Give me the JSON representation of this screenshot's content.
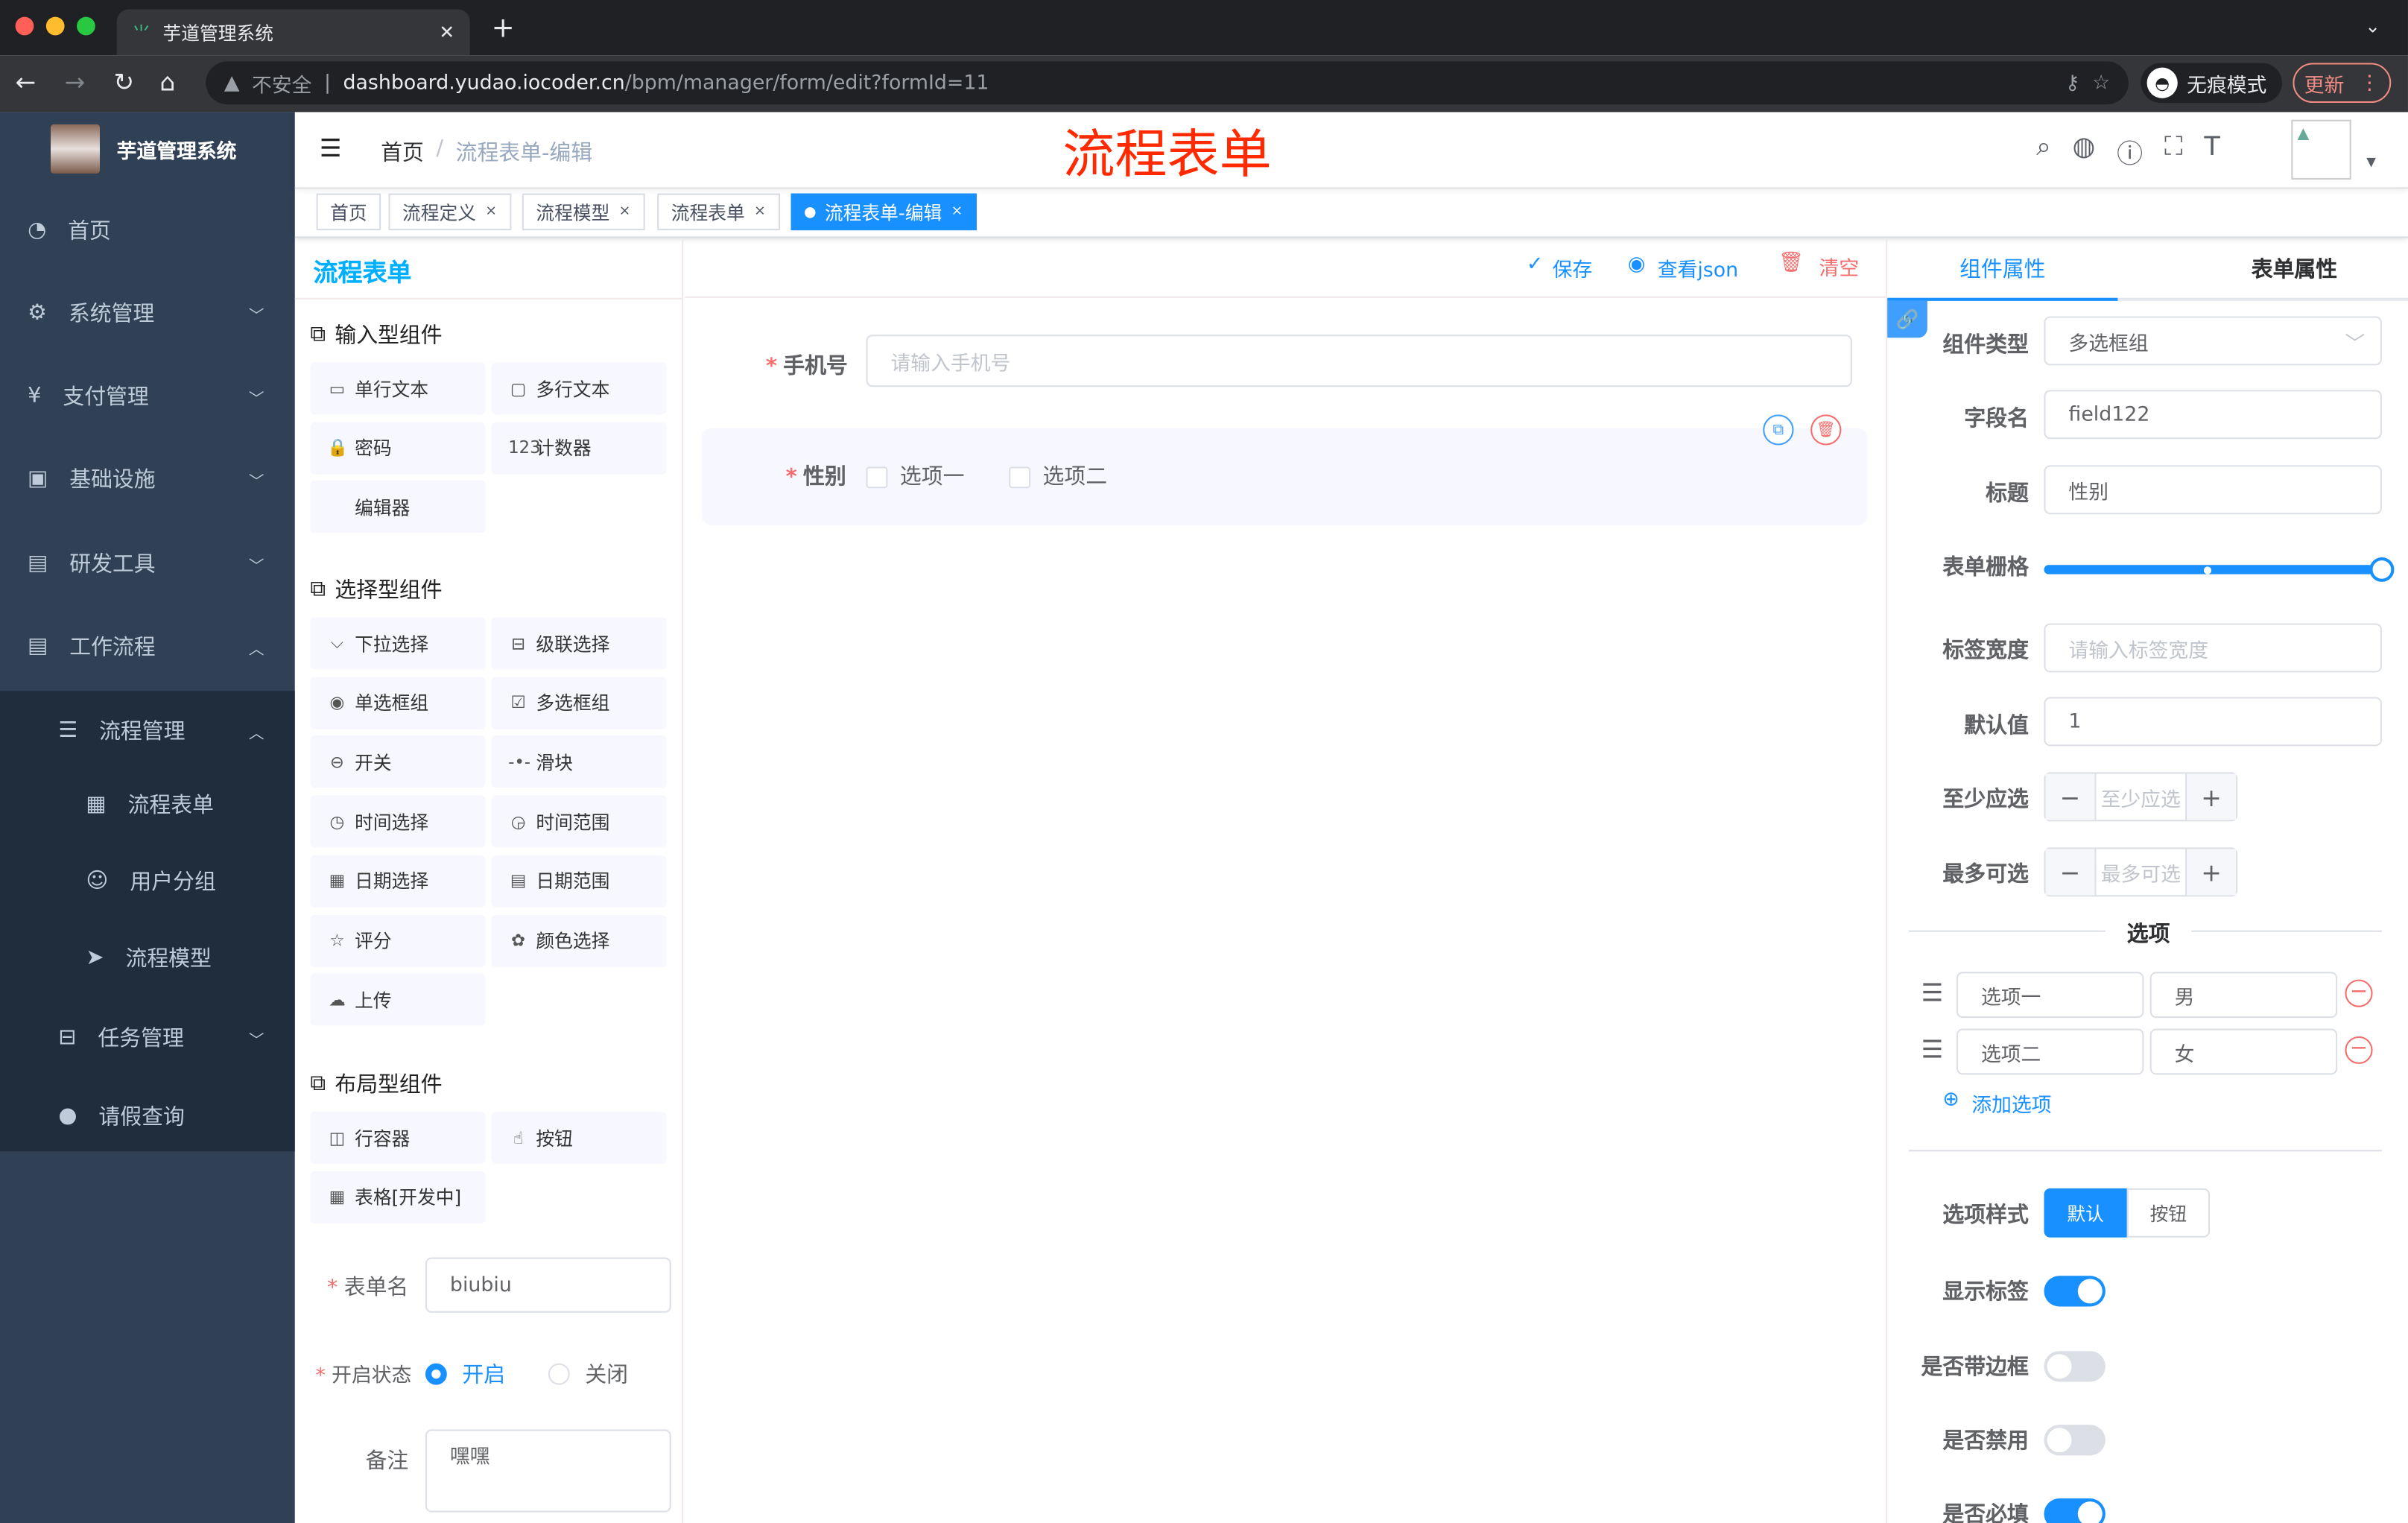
{
  "browser": {
    "tab_title": "芋道管理系统",
    "insecure": "不安全",
    "url_host": "dashboard.yudao.iocoder.cn",
    "url_path": "/bpm/manager/form/edit?formId=11",
    "incognito": "无痕模式",
    "update": "更新"
  },
  "sidebar": {
    "logo_title": "芋道管理系统",
    "items": [
      {
        "label": "首页",
        "icon": "dashboard-icon"
      },
      {
        "label": "系统管理",
        "icon": "gear-icon"
      },
      {
        "label": "支付管理",
        "icon": "yen-icon"
      },
      {
        "label": "基础设施",
        "icon": "monitor-icon"
      },
      {
        "label": "研发工具",
        "icon": "toolbox-icon"
      },
      {
        "label": "工作流程",
        "icon": "toolbox-icon"
      },
      {
        "label": "流程管理",
        "icon": "list-tree-icon"
      },
      {
        "label": "流程表单",
        "icon": "form-icon"
      },
      {
        "label": "用户分组",
        "icon": "people-icon"
      },
      {
        "label": "流程模型",
        "icon": "send-icon"
      },
      {
        "label": "任务管理",
        "icon": "tree-icon"
      },
      {
        "label": "请假查询",
        "icon": "user-icon"
      }
    ]
  },
  "navbar": {
    "breadcrumb": [
      "首页",
      "流程表单-编辑"
    ],
    "overlay_title": "流程表单"
  },
  "tags": [
    {
      "label": "首页"
    },
    {
      "label": "流程定义"
    },
    {
      "label": "流程模型"
    },
    {
      "label": "流程表单"
    },
    {
      "label": "流程表单-编辑",
      "active": true
    }
  ],
  "left": {
    "title": "流程表单",
    "categories": [
      {
        "title": "输入型组件",
        "items": [
          {
            "label": "单行文本",
            "icon": "input-icon"
          },
          {
            "label": "多行文本",
            "icon": "textarea-icon"
          },
          {
            "label": "密码",
            "icon": "lock-icon"
          },
          {
            "label": "计数器",
            "icon": "number-icon"
          },
          {
            "label": "编辑器",
            "icon": ""
          }
        ]
      },
      {
        "title": "选择型组件",
        "items": [
          {
            "label": "下拉选择",
            "icon": "select-icon"
          },
          {
            "label": "级联选择",
            "icon": "cascader-icon"
          },
          {
            "label": "单选框组",
            "icon": "radio-icon"
          },
          {
            "label": "多选框组",
            "icon": "checkbox-icon"
          },
          {
            "label": "开关",
            "icon": "switch-icon"
          },
          {
            "label": "滑块",
            "icon": "slider-icon"
          },
          {
            "label": "时间选择",
            "icon": "time-icon"
          },
          {
            "label": "时间范围",
            "icon": "time-range-icon"
          },
          {
            "label": "日期选择",
            "icon": "date-icon"
          },
          {
            "label": "日期范围",
            "icon": "date-range-icon"
          },
          {
            "label": "评分",
            "icon": "star-icon"
          },
          {
            "label": "颜色选择",
            "icon": "color-icon"
          },
          {
            "label": "上传",
            "icon": "upload-icon"
          }
        ]
      },
      {
        "title": "布局型组件",
        "items": [
          {
            "label": "行容器",
            "icon": "row-icon"
          },
          {
            "label": "按钮",
            "icon": "button-icon"
          },
          {
            "label": "表格[开发中]",
            "icon": "table-icon"
          }
        ]
      }
    ],
    "form_name_label": "表单名",
    "form_name": "biubiu",
    "status_label": "开启状态",
    "status_on": "开启",
    "status_off": "关闭",
    "remark_label": "备注",
    "remark": "嘿嘿"
  },
  "toolbar": {
    "save": "保存",
    "json": "查看json",
    "clear": "清空"
  },
  "canvas": {
    "phone_label": "手机号",
    "phone_placeholder": "请输入手机号",
    "gender_label": "性别",
    "options": [
      "选项一",
      "选项二"
    ]
  },
  "right": {
    "tabs": [
      "组件属性",
      "表单属性"
    ],
    "component_type_label": "组件类型",
    "component_type": "多选框组",
    "field_label": "字段名",
    "field": "field122",
    "title_label": "标题",
    "title": "性别",
    "grid_label": "表单栅格",
    "grid_value": 24,
    "grid_max": 24,
    "label_width_label": "标签宽度",
    "label_width_placeholder": "请输入标签宽度",
    "default_label": "默认值",
    "default": "1",
    "min_label": "至少应选",
    "min_placeholder": "至少应选",
    "max_label": "最多可选",
    "max_placeholder": "最多可选",
    "options_divider": "选项",
    "options": [
      {
        "label": "选项一",
        "value": "男"
      },
      {
        "label": "选项二",
        "value": "女"
      }
    ],
    "add_option": "添加选项",
    "style_label": "选项样式",
    "style_options": [
      "默认",
      "按钮"
    ],
    "show_label": "显示标签",
    "show_label_on": true,
    "border_label": "是否带边框",
    "border_on": false,
    "disabled_label": "是否禁用",
    "disabled_on": false,
    "required_label": "是否必填",
    "required_on": true
  },
  "colors": {
    "primary": "#1890ff",
    "sidebar": "#304156",
    "danger": "#f56c6c",
    "title_red": "#ff2a00"
  }
}
